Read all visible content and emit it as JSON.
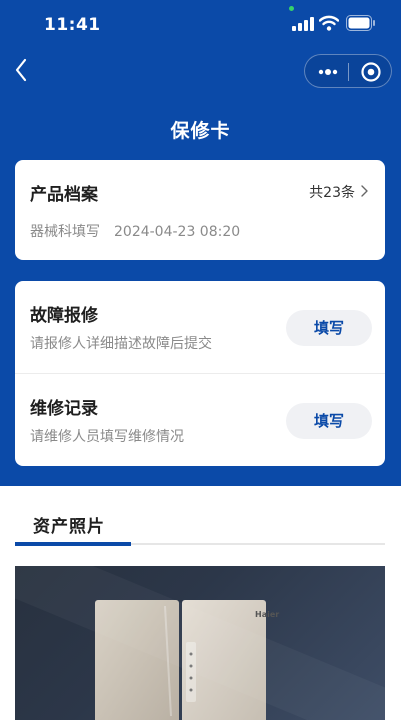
{
  "status_bar": {
    "time": "11:41"
  },
  "header": {
    "title": "保修卡"
  },
  "colors": {
    "primary": "#0b4aa8",
    "card_bg": "#ffffff",
    "button_bg": "#f0f1f4",
    "muted_text": "#8a8a8a"
  },
  "archive": {
    "title": "产品档案",
    "count": "共23条",
    "filled_by": "器械科填写",
    "datetime": "2024-04-23 08:20"
  },
  "actions": [
    {
      "title": "故障报修",
      "description": "请报修人详细描述故障后提交",
      "button": "填写"
    },
    {
      "title": "维修记录",
      "description": "请维修人员填写维修情况",
      "button": "填写"
    }
  ],
  "tabs": {
    "active": "资产照片"
  },
  "photo": {
    "brand": "Haier"
  },
  "icons": [
    "signal-icon",
    "wifi-icon",
    "battery-icon",
    "back-icon",
    "more-icon",
    "target-icon",
    "chevron-right-icon"
  ]
}
